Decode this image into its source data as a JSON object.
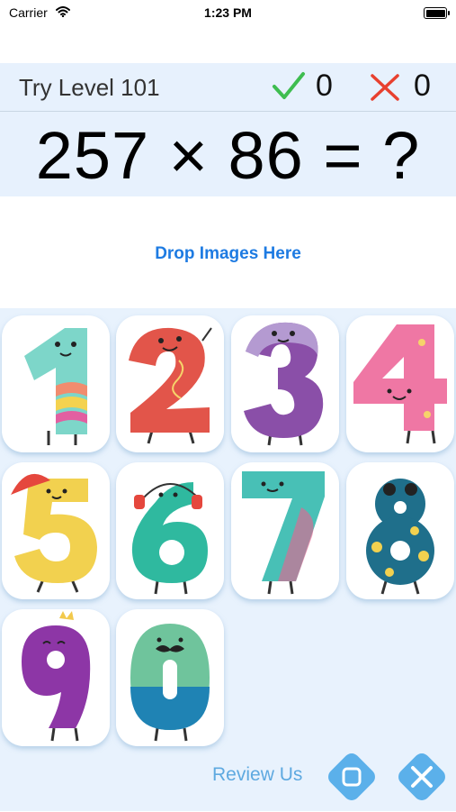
{
  "status_bar": {
    "carrier": "Carrier",
    "time": "1:23 PM"
  },
  "header": {
    "level_label": "Try Level 101",
    "correct_count": "0",
    "wrong_count": "0"
  },
  "equation": {
    "text": "257 × 86 = ?"
  },
  "drop_zone": {
    "label": "Drop Images Here"
  },
  "tiles": [
    {
      "digit": "1",
      "color": "#7dd6c9"
    },
    {
      "digit": "2",
      "color": "#e2554a"
    },
    {
      "digit": "3",
      "color": "#8a4fa8"
    },
    {
      "digit": "4",
      "color": "#ef77a4"
    },
    {
      "digit": "5",
      "color": "#f2d14f"
    },
    {
      "digit": "6",
      "color": "#2fb99f"
    },
    {
      "digit": "7",
      "color": "#48c0b6"
    },
    {
      "digit": "8",
      "color": "#1f6f8b"
    },
    {
      "digit": "9",
      "color": "#8d36a6"
    },
    {
      "digit": "0",
      "color": "#6fc49c"
    }
  ],
  "footer": {
    "review_label": "Review Us"
  },
  "colors": {
    "accent": "#1e7be2",
    "correct": "#3ebd50",
    "wrong": "#e8402f",
    "button": "#5bb0ea",
    "tray": "#e8f2fd"
  }
}
